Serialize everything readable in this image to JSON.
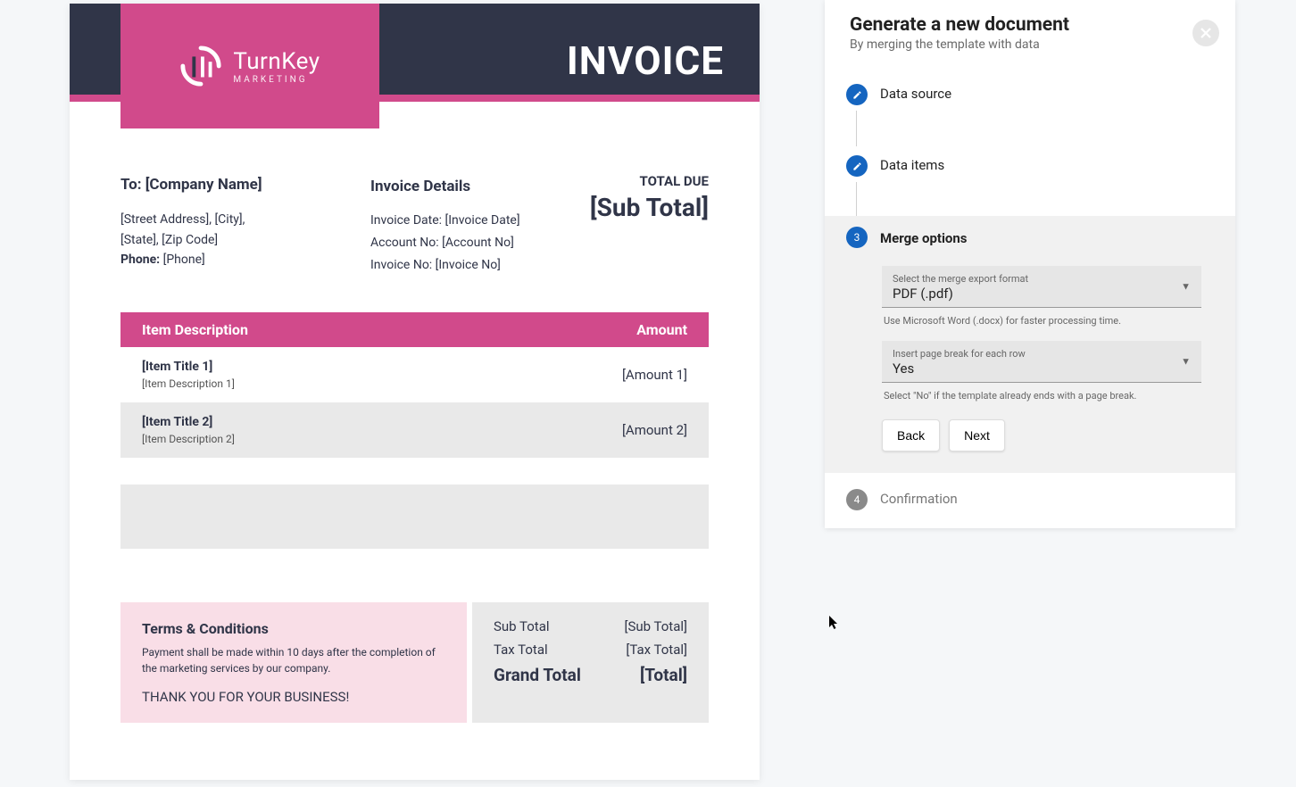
{
  "panel": {
    "title": "Generate a new document",
    "subtitle": "By merging the template with data",
    "steps": {
      "step1": "Data source",
      "step2": "Data items",
      "step3": "Merge options",
      "step4": "Confirmation",
      "step3_num": "3",
      "step4_num": "4"
    },
    "export_format": {
      "label": "Select the merge export format",
      "value": "PDF (.pdf)",
      "help": "Use Microsoft Word (.docx) for faster processing time."
    },
    "page_break": {
      "label": "Insert page break for each row",
      "value": "Yes",
      "help": "Select \"No\" if the template already ends with a page break."
    },
    "buttons": {
      "back": "Back",
      "next": "Next"
    }
  },
  "doc": {
    "logo": {
      "name": "TurnKey",
      "tagline": "Marketing"
    },
    "invoice_title": "INVOICE",
    "to": {
      "title": "To: [Company Name]",
      "line1": "[Street Address], [City],",
      "line2": "[State], [Zip Code]",
      "phone_label": "Phone:",
      "phone": "[Phone]"
    },
    "details": {
      "title": "Invoice Details",
      "date": "Invoice Date: [Invoice Date]",
      "account": "Account No: [Account No]",
      "number": "Invoice No: [Invoice No]"
    },
    "total_due": {
      "label": "TOTAL DUE",
      "value": "[Sub Total]"
    },
    "items_header": {
      "desc": "Item Description",
      "amount": "Amount"
    },
    "items": [
      {
        "title": "[Item Title 1]",
        "desc": "[Item Description 1]",
        "amount": "[Amount 1]"
      },
      {
        "title": "[Item Title 2]",
        "desc": "[Item Description 2]",
        "amount": "[Amount 2]"
      }
    ],
    "terms": {
      "title": "Terms & Conditions",
      "body": "Payment shall be made within 10 days after the completion of the marketing services by our company.",
      "thanks": "THANK YOU FOR YOUR BUSINESS!"
    },
    "totals": {
      "sub_label": "Sub Total",
      "sub_value": "[Sub Total]",
      "tax_label": "Tax Total",
      "tax_value": "[Tax Total]",
      "grand_label": "Grand Total",
      "grand_value": "[Total]"
    }
  }
}
